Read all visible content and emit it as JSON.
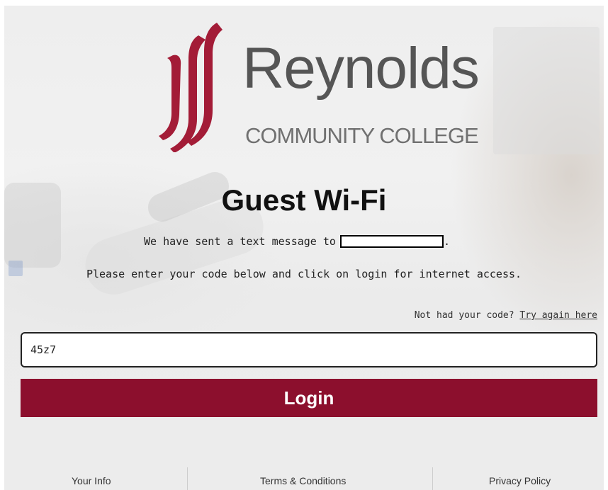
{
  "logo": {
    "name": "Reynolds",
    "subtitle": "COMMUNITY COLLEGE",
    "brand_color": "#a31c37"
  },
  "page": {
    "title": "Guest Wi-Fi",
    "sent_message": "We have sent a text message to",
    "sent_message_suffix": ".",
    "instruction": "Please enter your code below and click on login for internet access."
  },
  "retry": {
    "prompt": "Not had your code?",
    "link_label": "Try again here"
  },
  "code_input": {
    "value": "45z7"
  },
  "login": {
    "label": "Login",
    "color": "#8c0f2d"
  },
  "footer": {
    "links": [
      {
        "label": "Your Info"
      },
      {
        "label": "Terms & Conditions"
      },
      {
        "label": "Privacy Policy"
      }
    ]
  }
}
